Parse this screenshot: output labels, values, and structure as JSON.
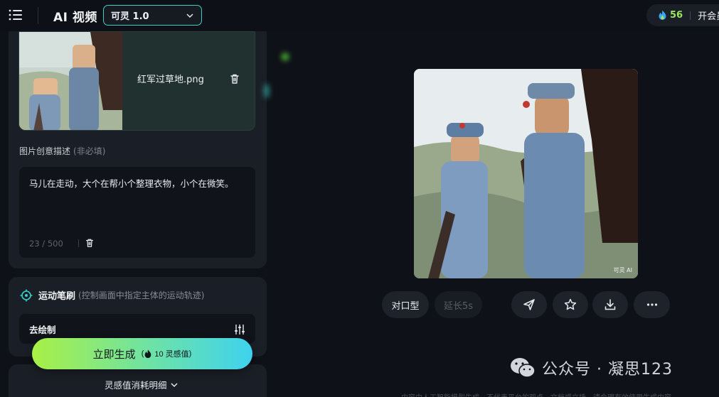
{
  "header": {
    "title": "AI 视频",
    "model": "可灵 1.0",
    "credits": "56",
    "member_label": "开会员"
  },
  "upload": {
    "file_name": "红军过草地.png",
    "desc_label": "图片创意描述",
    "desc_optional": "(非必填)",
    "desc_text": "马儿在走动，大个在帮小个整理衣物，小个在微笑。",
    "counter": "23 / 500"
  },
  "brush": {
    "title": "运动笔刷",
    "hint": "(控制画面中指定主体的运动轨迹)",
    "draw_label": "去绘制"
  },
  "generate": {
    "label": "立即生成",
    "cost": "10 灵感值",
    "detail": "灵感值消耗明细"
  },
  "preview": {
    "watermark": "可灵 AI"
  },
  "actions": {
    "lip_sync": "对口型",
    "extend": "延长5s"
  },
  "footer": {
    "wechat_account": "公众号 · 凝思123",
    "note": "内容由人工智能模型生成，不代表平台的观点，文档或立场，请合理有效使用生成内容"
  },
  "colors": {
    "accent": "#3ad0c6",
    "credits": "#9be65c",
    "generate_start": "#a8f046",
    "generate_end": "#3fd2ee"
  },
  "icons": [
    "menu-icon",
    "chevron-down-icon",
    "fire-icon",
    "trash-icon",
    "brush-target-icon",
    "sliders-icon",
    "send-icon",
    "star-icon",
    "download-icon",
    "more-icon",
    "wechat-icon"
  ]
}
